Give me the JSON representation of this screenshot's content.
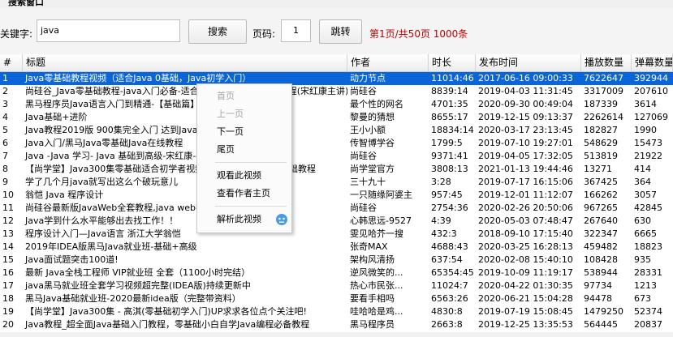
{
  "window": {
    "title": "搜索窗口"
  },
  "toolbar": {
    "keyword_label": "关键字:",
    "keyword_value": "java",
    "search_label": "搜索",
    "page_label": "页码:",
    "page_value": "1",
    "jump_label": "跳转",
    "page_info": "第1页/共50页 1000条"
  },
  "table": {
    "headers": [
      "#",
      "标题",
      "作者",
      "时长",
      "发布时间",
      "播放数量",
      "弹幕数量"
    ],
    "rows": [
      [
        "1",
        "Java零基础教程视频（适合Java 0基础，Java初学入门）",
        "动力节点",
        "11014:46",
        "2017-06-16 09:00:33",
        "7622647",
        "392944"
      ],
      [
        "2",
        "尚硅谷_Java零基础教程-java入门必备-适合初学者的全套完整版教程(宋红康主讲)",
        "尚硅谷",
        "8839:14",
        "2019-04-03 11:31:45",
        "3317009",
        "207610"
      ],
      [
        "3",
        "黑马程序员Java语言入门到精通-【基础篇】零基础入门(IDEA版)",
        "最个性的网名",
        "4701:35",
        "2020-09-30 00:49:04",
        "187339",
        "3614"
      ],
      [
        "4",
        "Java基础+进阶",
        "黎曼的猜想",
        "8655:17",
        "2019-12-15 09:13:37",
        "2262614",
        "127069"
      ],
      [
        "5",
        "Java教程2019版 900集完全入门 达到Java工程师",
        "王小小额",
        "18834:14",
        "2020-03-17 23:13:45",
        "182827",
        "1990"
      ],
      [
        "6",
        "Java入门/黑马Java零基础Java在线教程",
        "传智博学谷",
        "1799:5",
        "2019-07-10 19:27:01",
        "548629",
        "15473"
      ],
      [
        "7",
        "Java -Java 学习- Java 基础到高级-宋红康-零基础自学Java-尚硅谷",
        "尚硅谷",
        "9371:41",
        "2019-04-05 17:32:05",
        "513819",
        "21922"
      ],
      [
        "8",
        "【尚学堂】Java300集零基础适合初学者视频教程_Java300集零基础教程",
        "尚学堂官方",
        "3808:13",
        "2021-01-13 19:44:46",
        "13271",
        "414"
      ],
      [
        "9",
        "学了几个月java就写出这么个破玩意儿",
        "三十九十",
        "3:28",
        "2019-07-17 16:15:06",
        "367425",
        "364"
      ],
      [
        "10",
        "翁恺  Java 程序设计",
        "一只随缘阿婆主",
        "957:45",
        "2019-12-01 11:12:07",
        "166262",
        "3057"
      ],
      [
        "11",
        "尚硅谷最新版JavaWeb全套教程,java web零基础入门完整版",
        "尚硅谷",
        "2754:36",
        "2020-02-26 20:50:06",
        "967265",
        "42845"
      ],
      [
        "12",
        "Java学到什么水平能够出去找工作！！",
        "心韩思远-9527",
        "4:39",
        "2020-05-03 07:48:47",
        "267640",
        "630"
      ],
      [
        "13",
        "程序设计入门—Java语言 浙江大学翁恺",
        "雯见哈芥一搜",
        "432:3",
        "2018-09-10 17:15:40",
        "322347",
        "6665"
      ],
      [
        "14",
        "2019年IDEA版黑马Java就业班-基础+高级",
        "张奇MAX",
        "4688:43",
        "2020-03-25 16:28:13",
        "459482",
        "18823"
      ],
      [
        "15",
        "Java面试题突击100道!",
        "架构风清扬",
        "637:54",
        "2020-02-08 15:40:10",
        "108428",
        "935"
      ],
      [
        "16",
        "最新 Java全栈工程师 VIP就业班 全套（1100小时完结）",
        "逆风微笑的...",
        "65354:45",
        "2019-10-09 11:19:17",
        "538944",
        "28331"
      ],
      [
        "17",
        "java黑马就业班全套学习视频超完整(IDEA版)持续更新中",
        "热心市民张...",
        "11024:7",
        "2020-04-22 01:30:35",
        "97734",
        "1213"
      ],
      [
        "18",
        "黑马Java基础就业班-2020最新idea版（完整带资料）",
        "要看手相吗",
        "6563:26",
        "2020-06-21 15:04:28",
        "94478",
        "673"
      ],
      [
        "19",
        "【尚学堂】Java300集 - 高淇(零基础初学入门)UP求求各位点个关注吧!",
        "哇哈哈是鸡...",
        "4830:8",
        "2019-07-19 15:08:45",
        "1479250",
        "52374"
      ],
      [
        "20",
        "Java教程_超全面Java基础入门教程，零基础小白自学Java编程必备教程",
        "黑马程序员",
        "2663:8",
        "2019-12-25 13:35:53",
        "564445",
        "20837"
      ]
    ]
  },
  "context_menu": {
    "items": [
      {
        "label": "首页",
        "disabled": true
      },
      {
        "label": "上一页",
        "disabled": true
      },
      {
        "label": "下一页",
        "disabled": false
      },
      {
        "label": "尾页",
        "disabled": false
      },
      {
        "label": "观看此视频",
        "disabled": false
      },
      {
        "label": "查看作者主页",
        "disabled": false
      },
      {
        "label": "解析此视频",
        "disabled": false
      }
    ]
  },
  "colors": {
    "selection": "#0a66d8",
    "page_info": "#c00000"
  }
}
